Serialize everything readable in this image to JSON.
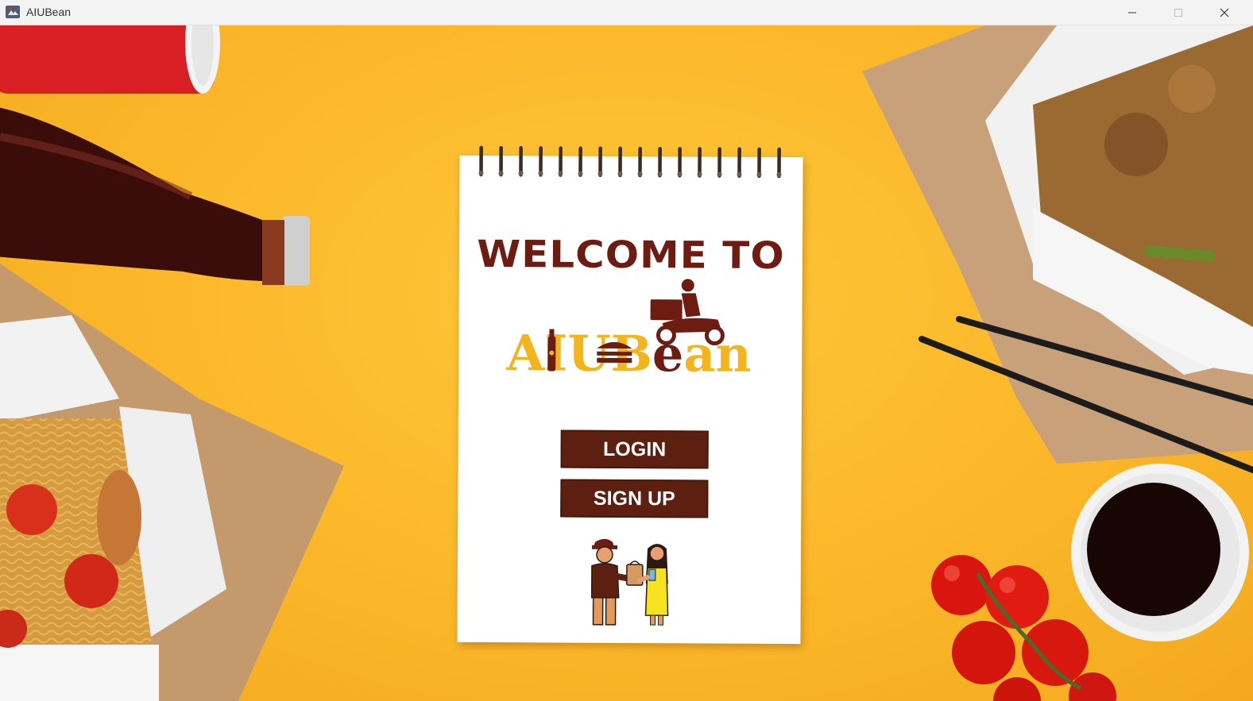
{
  "window": {
    "title": "AIUBean"
  },
  "welcome": {
    "heading": "WELCOME TO"
  },
  "logo": {
    "text": "AIUBean"
  },
  "buttons": {
    "login": "LOGIN",
    "signup": "SIGN UP"
  },
  "colors": {
    "background": "#f7b82a",
    "brand_brown": "#6e1c12",
    "button": "#5c1f10",
    "logo_yellow": "#f4b41b"
  },
  "icons": [
    "app-icon",
    "minimize-icon",
    "maximize-icon",
    "close-icon",
    "delivery-scooter-icon",
    "bottle-icon",
    "burger-icon",
    "delivery-handoff-illustration"
  ]
}
